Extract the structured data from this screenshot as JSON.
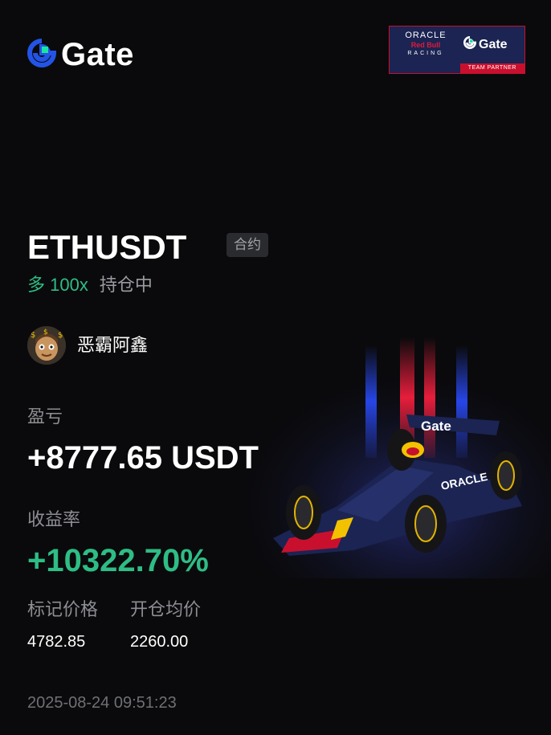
{
  "brand": {
    "logo_text": "Gate"
  },
  "partner": {
    "oracle": "ORACLE",
    "redbull": "Red Bull",
    "racing": "RACING",
    "gate": "Gate",
    "team_partner": "TEAM PARTNER"
  },
  "position": {
    "pair": "ETHUSDT",
    "contract_tag": "合约",
    "direction": "多 100x",
    "status": "持仓中"
  },
  "user": {
    "name": "恶霸阿鑫",
    "avatar": "cartoon-avatar"
  },
  "pnl": {
    "label": "盈亏",
    "value": "+8777.65 USDT"
  },
  "roi": {
    "label": "收益率",
    "value": "+10322.70%"
  },
  "prices": {
    "mark_label": "标记价格",
    "mark_value": "4782.85",
    "entry_label": "开仓均价",
    "entry_value": "2260.00"
  },
  "timestamp": "2025-08-24 09:51:23",
  "colors": {
    "background": "#0a0a0c",
    "profit_green": "#2ebd85",
    "muted_text": "#8d8e93",
    "gate_blue": "#2354e6",
    "gate_green": "#17e6a1",
    "redbull_red": "#c8102e",
    "redbull_navy": "#1b2452"
  },
  "icons": {
    "logo": "gate-logo-icon",
    "artwork": "f1-race-car-artwork"
  }
}
